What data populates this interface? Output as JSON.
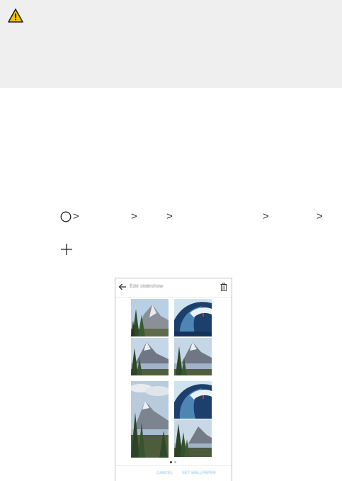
{
  "caution": {
    "icon": "warning-triangle-icon",
    "background": "#f0efef",
    "icon_color": "#f2c200"
  },
  "navigation_steps": {
    "start_icon": "home-circle-icon",
    "separator": ">",
    "separator_count": 5
  },
  "add_control": {
    "icon": "plus-icon"
  },
  "phone_screen": {
    "title": "Edit slideshow",
    "back_icon": "arrow-back-icon",
    "delete_icon": "trash-icon",
    "page_indicator": {
      "pages": 2,
      "current": 1,
      "active_color": "#333333",
      "inactive_color": "#bbbbbb"
    },
    "cancel_label": "CANCEL",
    "set_wallpaper_label": "SET WALLPAPER",
    "accent": "#7fb8e6",
    "thumbnails": [
      {
        "name": "thumb-mountain-forest",
        "scene": "mountain-forest"
      },
      {
        "name": "thumb-wave-surfer",
        "scene": "wave"
      },
      {
        "name": "thumb-mountain-lake",
        "scene": "mountain-lake"
      },
      {
        "name": "thumb-mountain-lake",
        "scene": "mountain-lake"
      },
      {
        "name": "thumb-mountain-clouds",
        "scene": "mountain-clouds"
      },
      {
        "name": "thumb-wave-surfer",
        "scene": "wave"
      },
      {
        "name": "thumb-forest-lake",
        "scene": "forest-lake"
      },
      {
        "name": "thumb-mountain-lake",
        "scene": "mountain-lake"
      }
    ]
  }
}
